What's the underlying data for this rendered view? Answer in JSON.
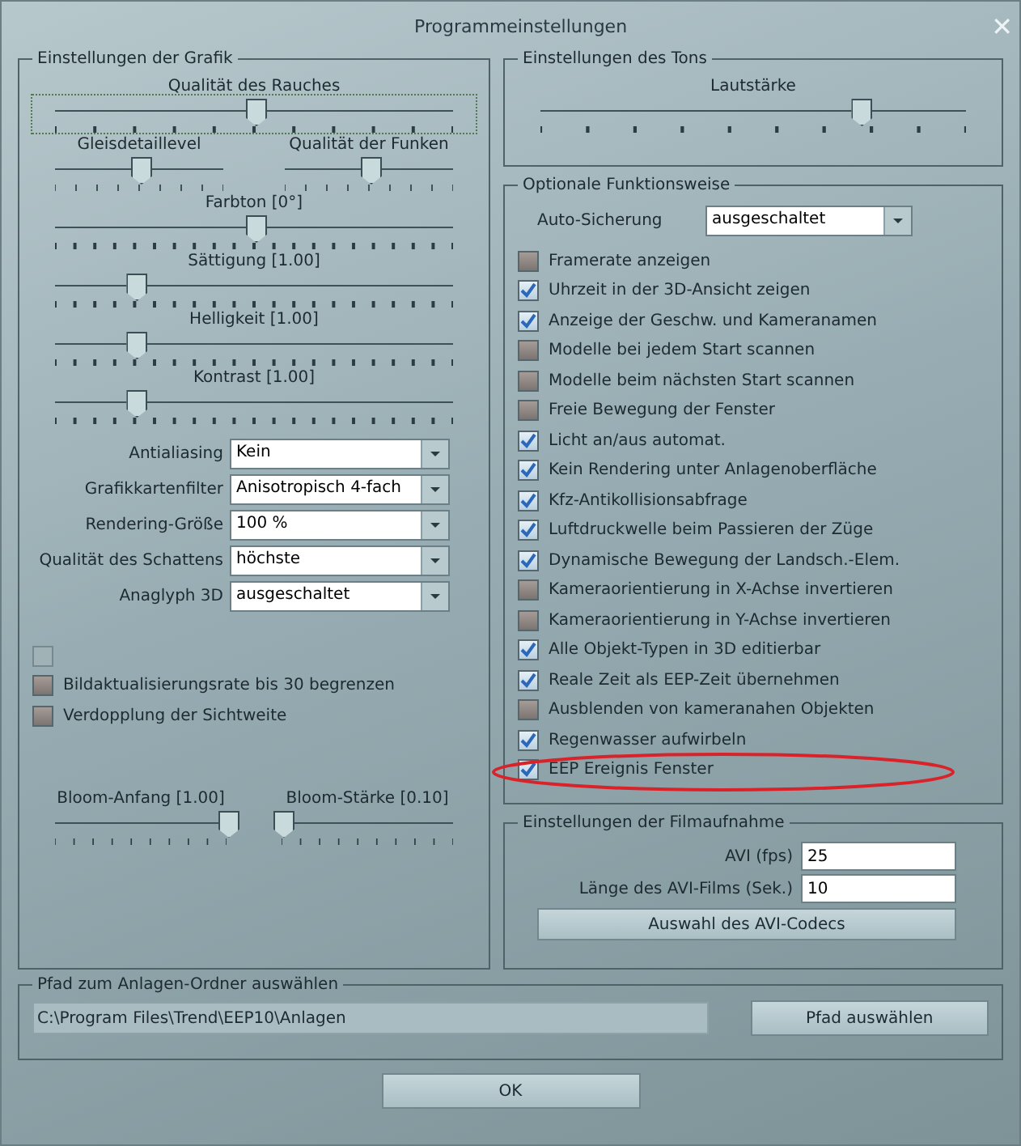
{
  "window": {
    "title": "Programmeinstellungen",
    "close": "✕"
  },
  "graphics": {
    "title": "Einstellungen der Grafik",
    "slider_rows": [
      [
        {
          "label": "Qualität des Rauches",
          "level": 0.5,
          "focused": true
        }
      ],
      [
        {
          "label": "Gleisdetaillevel",
          "level": 0.5,
          "focused": false
        },
        {
          "label": "Qualität der Funken",
          "level": 0.5,
          "focused": false
        }
      ],
      [
        {
          "label": "Farbton [0°]",
          "level": 0.5,
          "focused": false
        }
      ],
      [
        {
          "label": "Sättigung [1.00]",
          "level": 0.2,
          "focused": false
        }
      ],
      [
        {
          "label": "Helligkeit [1.00]",
          "level": 0.2,
          "focused": false
        }
      ],
      [
        {
          "label": "Kontrast [1.00]",
          "level": 0.2,
          "focused": false
        }
      ]
    ],
    "dropdowns": [
      {
        "label": "Antialiasing",
        "value": "Kein"
      },
      {
        "label": "Grafikkartenfilter",
        "value": "Anisotropisch 4-fach"
      },
      {
        "label": "Rendering-Größe",
        "value": "100 %"
      },
      {
        "label": "Qualität des Schattens",
        "value": "höchste"
      },
      {
        "label": "Anaglyph 3D",
        "value": "ausgeschaltet"
      }
    ],
    "checkboxes": [
      {
        "checked": false,
        "disabled": true
      },
      {
        "label": "Bildaktualisierungsrate bis 30 begrenzen",
        "checked": false,
        "disabled": false
      },
      {
        "label": "Verdopplung der Sichtweite",
        "checked": false,
        "disabled": false
      }
    ],
    "bloom": [
      {
        "label": "Bloom-Anfang [1.00]",
        "level": 1.0
      },
      {
        "label": "Bloom-Stärke [0.10]",
        "level": 0.0
      }
    ]
  },
  "sound": {
    "title": "Einstellungen des Tons",
    "slider": {
      "label": "Lautstärke",
      "level": 0.75
    }
  },
  "optional": {
    "title": "Optionale Funktionsweise",
    "autosave": {
      "label": "Auto-Sicherung",
      "value": "ausgeschaltet"
    },
    "checkboxes": [
      {
        "label": "Framerate anzeigen",
        "checked": false,
        "highlighted": false
      },
      {
        "label": "Uhrzeit in der 3D-Ansicht zeigen",
        "checked": true,
        "highlighted": false
      },
      {
        "label": "Anzeige der Geschw. und Kameranamen",
        "checked": true,
        "highlighted": false
      },
      {
        "label": "Modelle bei jedem Start scannen",
        "checked": false,
        "highlighted": false
      },
      {
        "label": "Modelle beim nächsten Start scannen",
        "checked": false,
        "highlighted": false
      },
      {
        "label": "Freie Bewegung der Fenster",
        "checked": false,
        "highlighted": false
      },
      {
        "label": "Licht an/aus automat.",
        "checked": true,
        "highlighted": false
      },
      {
        "label": "Kein Rendering unter Anlagenoberfläche",
        "checked": true,
        "highlighted": false
      },
      {
        "label": "Kfz-Antikollisionsabfrage",
        "checked": true,
        "highlighted": false
      },
      {
        "label": "Luftdruckwelle beim Passieren der Züge",
        "checked": true,
        "highlighted": false
      },
      {
        "label": "Dynamische Bewegung der Landsch.-Elem.",
        "checked": true,
        "highlighted": false
      },
      {
        "label": "Kameraorientierung in X-Achse invertieren",
        "checked": false,
        "highlighted": false
      },
      {
        "label": "Kameraorientierung in Y-Achse invertieren",
        "checked": false,
        "highlighted": false
      },
      {
        "label": "Alle Objekt-Typen in 3D editierbar",
        "checked": true,
        "highlighted": false
      },
      {
        "label": "Reale Zeit als EEP-Zeit übernehmen",
        "checked": true,
        "highlighted": false
      },
      {
        "label": "Ausblenden von kameranahen Objekten",
        "checked": false,
        "highlighted": false
      },
      {
        "label": "Regenwasser aufwirbeln",
        "checked": true,
        "highlighted": false
      },
      {
        "label": "EEP Ereignis Fenster",
        "checked": true,
        "highlighted": true
      }
    ]
  },
  "film": {
    "title": "Einstellungen der Filmaufnahme",
    "fields": [
      {
        "label": "AVI (fps)",
        "value": "25"
      },
      {
        "label": "Länge des AVI-Films (Sek.)",
        "value": "10"
      }
    ],
    "button": "Auswahl des AVI-Codecs"
  },
  "path": {
    "title": "Pfad zum Anlagen-Ordner auswählen",
    "value": "C:\\Program Files\\Trend\\EEP10\\Anlagen",
    "button": "Pfad auswählen"
  },
  "ok": "OK"
}
